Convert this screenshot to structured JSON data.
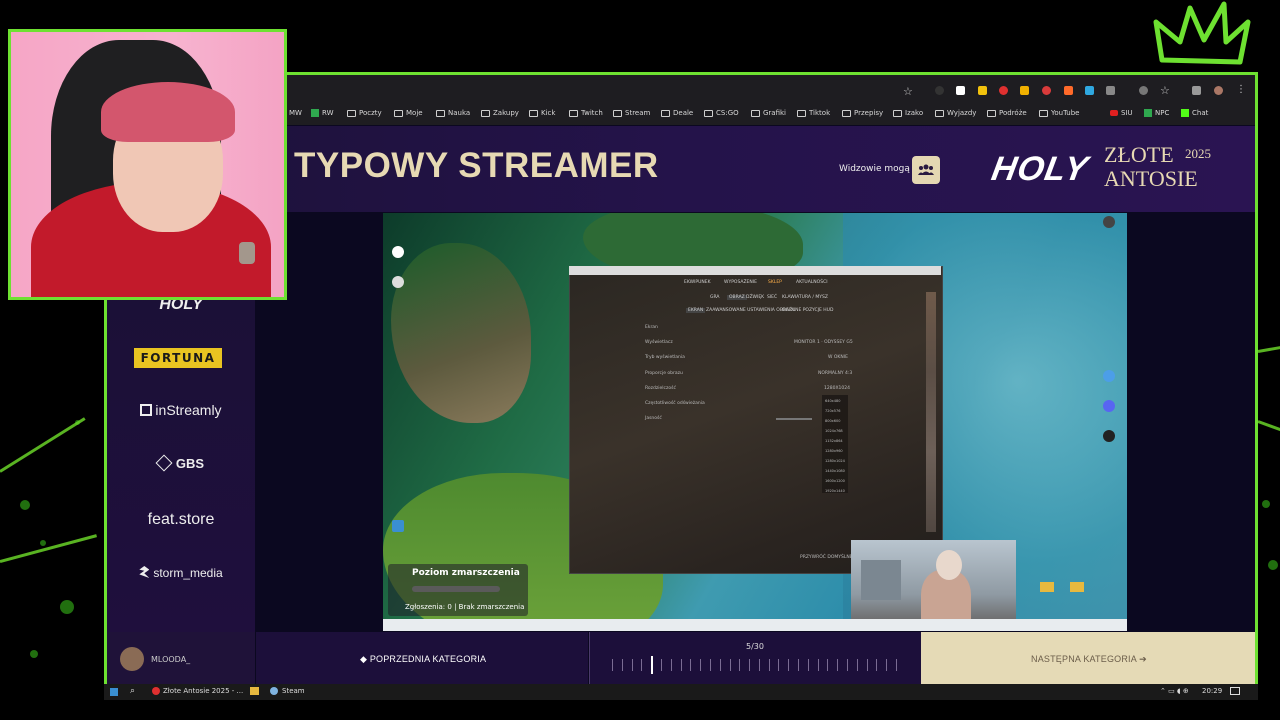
{
  "window": {
    "title": "Złote Antosie 2025"
  },
  "bookmarks": [
    {
      "label": "MW",
      "icon": "none"
    },
    {
      "label": "RW",
      "icon": "green-plus-icon"
    },
    {
      "label": "Poczty",
      "icon": "folder-icon"
    },
    {
      "label": "Moje",
      "icon": "folder-icon"
    },
    {
      "label": "Nauka",
      "icon": "folder-icon"
    },
    {
      "label": "Zakupy",
      "icon": "folder-icon"
    },
    {
      "label": "Kick",
      "icon": "folder-icon"
    },
    {
      "label": "Twitch",
      "icon": "folder-icon"
    },
    {
      "label": "Stream",
      "icon": "folder-icon"
    },
    {
      "label": "Deale",
      "icon": "folder-icon"
    },
    {
      "label": "CS:GO",
      "icon": "folder-icon"
    },
    {
      "label": "Grafiki",
      "icon": "folder-icon"
    },
    {
      "label": "Tiktok",
      "icon": "folder-icon"
    },
    {
      "label": "Przepisy",
      "icon": "folder-icon"
    },
    {
      "label": "Izako",
      "icon": "folder-icon"
    },
    {
      "label": "Wyjazdy",
      "icon": "folder-icon"
    },
    {
      "label": "Podróże",
      "icon": "folder-icon"
    },
    {
      "label": "YouTube",
      "icon": "folder-icon"
    },
    {
      "label": "SIU",
      "icon": "youtube-icon"
    },
    {
      "label": "NPC",
      "icon": "green-plus-icon"
    },
    {
      "label": "Chat",
      "icon": "kick-icon"
    }
  ],
  "header": {
    "title": "TYPOWY STREAMER",
    "viewers_label": "Widzowie mogą",
    "logo_holy": "HOLY",
    "logo_zlote": "ZŁOTE",
    "logo_antosie": "ANTOSIE",
    "logo_year": "2025"
  },
  "sponsors": {
    "holy": "HOLY",
    "fortuna": "FORTUNA",
    "instreamly": "inStreamly",
    "gbs": "GBS",
    "featstore": "feat.store",
    "storm": "storm_media"
  },
  "game_window": {
    "tabs": [
      "EKWIPUNEK",
      "WYPOSAŻENIE",
      "SKLEP",
      "AKTUALNOŚCI"
    ],
    "subtabs": [
      "GRA",
      "OBRAZ",
      "DŹWIĘK",
      "SIEĆ",
      "KLAWIATURA / MYSZ"
    ],
    "subsubtabs": [
      "EKRAN",
      "ZAAWANSOWANE USTAWIENIA OBRAZU",
      "OGÓLNE POZYCJE HUD"
    ],
    "settings": [
      {
        "label": "Ekran",
        "value": ""
      },
      {
        "label": "Wyświetlacz",
        "value": "MONITOR 1 · ODYSSEY G5"
      },
      {
        "label": "Tryb wyświetlania",
        "value": "W OKNIE"
      },
      {
        "label": "Proporcje obrazu",
        "value": "NORMALNY 4:3"
      },
      {
        "label": "Rozdzielczość",
        "value": "1280X1024"
      },
      {
        "label": "Częstotliwość odświeżania",
        "value": ""
      },
      {
        "label": "Jasność",
        "value": ""
      }
    ],
    "resolutions": [
      "640x480",
      "720x576",
      "800x600",
      "1024x768",
      "1152x864",
      "1280x960",
      "1280x1024",
      "1440x1080",
      "1600x1200",
      "1920x1440"
    ],
    "reset_label": "PRZYWRÓĆ DOMYŚLNE"
  },
  "overlay": {
    "title": "Poziom zmarszczenia",
    "status": "Zgłoszenia: 0 | Brak zmarszczenia"
  },
  "bottom_bar": {
    "user": "MLOODA_",
    "prev": "POPRZEDNIA KATEGORIA",
    "progress": "5/30",
    "progress_current": 5,
    "progress_total": 30,
    "next": "NASTĘPNA KATEGORIA"
  },
  "taskbar": {
    "tab1": "Złote Antosie 2025 - ...",
    "tab2": "Steam",
    "clock": "20:29"
  },
  "colors": {
    "accent_green": "#6ee131",
    "gold": "#e7d9b3",
    "purple": "#1c0f3a",
    "fortuna_yellow": "#e9c421"
  }
}
